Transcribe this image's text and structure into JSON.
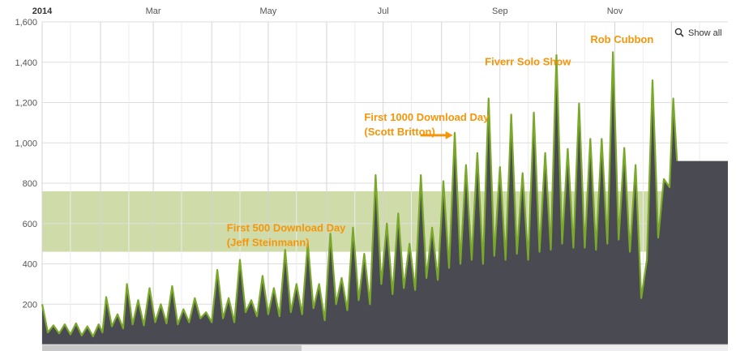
{
  "chart_data": {
    "type": "area",
    "x_start": "2014-01-01",
    "x_end": "2014-12-31",
    "ylim": [
      0,
      1600
    ],
    "yticks": [
      200,
      400,
      600,
      800,
      "1,000",
      "1,200",
      "1,400",
      "1,600"
    ],
    "ytick_values": [
      200,
      400,
      600,
      800,
      1000,
      1200,
      1400,
      1600
    ],
    "xticks": [
      {
        "label": "2014",
        "date": "2014-01-01",
        "bold": true
      },
      {
        "label": "Mar",
        "date": "2014-03-01",
        "bold": false
      },
      {
        "label": "May",
        "date": "2014-05-01",
        "bold": false
      },
      {
        "label": "Jul",
        "date": "2014-07-01",
        "bold": false
      },
      {
        "label": "Sep",
        "date": "2014-09-01",
        "bold": false
      },
      {
        "label": "Nov",
        "date": "2014-11-01",
        "bold": false
      }
    ],
    "grid": true,
    "band": {
      "y_from": 460,
      "y_to": 760,
      "color": "#cfdcaa"
    },
    "series": [
      {
        "line_color": "#7aa82a",
        "fill_color": "#4a4a52",
        "points": [
          [
            "2014-01-01",
            200
          ],
          [
            "2014-01-04",
            60
          ],
          [
            "2014-01-07",
            95
          ],
          [
            "2014-01-10",
            55
          ],
          [
            "2014-01-13",
            100
          ],
          [
            "2014-01-16",
            50
          ],
          [
            "2014-01-19",
            105
          ],
          [
            "2014-01-22",
            45
          ],
          [
            "2014-01-25",
            90
          ],
          [
            "2014-01-28",
            40
          ],
          [
            "2014-01-31",
            100
          ],
          [
            "2014-02-02",
            60
          ],
          [
            "2014-02-04",
            235
          ],
          [
            "2014-02-07",
            90
          ],
          [
            "2014-02-10",
            150
          ],
          [
            "2014-02-13",
            80
          ],
          [
            "2014-02-15",
            300
          ],
          [
            "2014-02-18",
            100
          ],
          [
            "2014-02-21",
            220
          ],
          [
            "2014-02-24",
            95
          ],
          [
            "2014-02-27",
            280
          ],
          [
            "2014-03-02",
            110
          ],
          [
            "2014-03-05",
            200
          ],
          [
            "2014-03-08",
            105
          ],
          [
            "2014-03-11",
            290
          ],
          [
            "2014-03-14",
            100
          ],
          [
            "2014-03-17",
            175
          ],
          [
            "2014-03-20",
            110
          ],
          [
            "2014-03-23",
            230
          ],
          [
            "2014-03-26",
            130
          ],
          [
            "2014-03-29",
            160
          ],
          [
            "2014-04-01",
            110
          ],
          [
            "2014-04-04",
            370
          ],
          [
            "2014-04-07",
            130
          ],
          [
            "2014-04-10",
            230
          ],
          [
            "2014-04-13",
            110
          ],
          [
            "2014-04-16",
            420
          ],
          [
            "2014-04-19",
            160
          ],
          [
            "2014-04-22",
            220
          ],
          [
            "2014-04-25",
            140
          ],
          [
            "2014-04-28",
            340
          ],
          [
            "2014-05-01",
            150
          ],
          [
            "2014-05-04",
            280
          ],
          [
            "2014-05-07",
            140
          ],
          [
            "2014-05-10",
            470
          ],
          [
            "2014-05-13",
            160
          ],
          [
            "2014-05-16",
            300
          ],
          [
            "2014-05-19",
            150
          ],
          [
            "2014-05-22",
            500
          ],
          [
            "2014-05-25",
            180
          ],
          [
            "2014-05-28",
            300
          ],
          [
            "2014-05-31",
            120
          ],
          [
            "2014-06-03",
            550
          ],
          [
            "2014-06-06",
            200
          ],
          [
            "2014-06-09",
            330
          ],
          [
            "2014-06-12",
            170
          ],
          [
            "2014-06-15",
            580
          ],
          [
            "2014-06-18",
            220
          ],
          [
            "2014-06-21",
            450
          ],
          [
            "2014-06-24",
            200
          ],
          [
            "2014-06-27",
            840
          ],
          [
            "2014-06-30",
            300
          ],
          [
            "2014-07-03",
            600
          ],
          [
            "2014-07-06",
            250
          ],
          [
            "2014-07-09",
            650
          ],
          [
            "2014-07-12",
            280
          ],
          [
            "2014-07-15",
            500
          ],
          [
            "2014-07-18",
            270
          ],
          [
            "2014-07-21",
            840
          ],
          [
            "2014-07-24",
            330
          ],
          [
            "2014-07-27",
            580
          ],
          [
            "2014-07-30",
            320
          ],
          [
            "2014-08-02",
            810
          ],
          [
            "2014-08-05",
            380
          ],
          [
            "2014-08-08",
            1050
          ],
          [
            "2014-08-11",
            400
          ],
          [
            "2014-08-14",
            890
          ],
          [
            "2014-08-17",
            420
          ],
          [
            "2014-08-20",
            950
          ],
          [
            "2014-08-23",
            400
          ],
          [
            "2014-08-26",
            1220
          ],
          [
            "2014-08-29",
            440
          ],
          [
            "2014-09-01",
            880
          ],
          [
            "2014-09-04",
            420
          ],
          [
            "2014-09-07",
            1140
          ],
          [
            "2014-09-10",
            450
          ],
          [
            "2014-09-13",
            850
          ],
          [
            "2014-09-16",
            420
          ],
          [
            "2014-09-19",
            1150
          ],
          [
            "2014-09-22",
            460
          ],
          [
            "2014-09-25",
            950
          ],
          [
            "2014-09-28",
            470
          ],
          [
            "2014-10-01",
            1435
          ],
          [
            "2014-10-04",
            500
          ],
          [
            "2014-10-07",
            970
          ],
          [
            "2014-10-10",
            480
          ],
          [
            "2014-10-13",
            1195
          ],
          [
            "2014-10-16",
            480
          ],
          [
            "2014-10-19",
            1020
          ],
          [
            "2014-10-22",
            470
          ],
          [
            "2014-10-25",
            1020
          ],
          [
            "2014-10-28",
            500
          ],
          [
            "2014-10-31",
            1450
          ],
          [
            "2014-11-03",
            520
          ],
          [
            "2014-11-06",
            975
          ],
          [
            "2014-11-09",
            460
          ],
          [
            "2014-11-12",
            890
          ],
          [
            "2014-11-15",
            230
          ],
          [
            "2014-11-18",
            420
          ],
          [
            "2014-11-21",
            1310
          ],
          [
            "2014-11-24",
            530
          ],
          [
            "2014-11-27",
            820
          ],
          [
            "2014-11-30",
            780
          ],
          [
            "2014-12-02",
            1220
          ],
          [
            "2014-12-04",
            910
          ]
        ]
      }
    ],
    "annotations": [
      {
        "lines": [
          "First 500 Download Day",
          "(Jeff Steinmann)"
        ],
        "date": "2014-04-09",
        "y": 560
      },
      {
        "lines": [
          "First 1000 Download Day",
          "(Scott Britton)"
        ],
        "date": "2014-06-21",
        "y": 1110,
        "arrow_to": {
          "date": "2014-08-07",
          "y": 1050
        }
      },
      {
        "lines": [
          "Fiverr Solo Show"
        ],
        "date": "2014-08-24",
        "y": 1385
      },
      {
        "lines": [
          "Rob Cubbon"
        ],
        "date": "2014-10-19",
        "y": 1495
      }
    ]
  },
  "controls": {
    "show_all_label": "Show all"
  }
}
